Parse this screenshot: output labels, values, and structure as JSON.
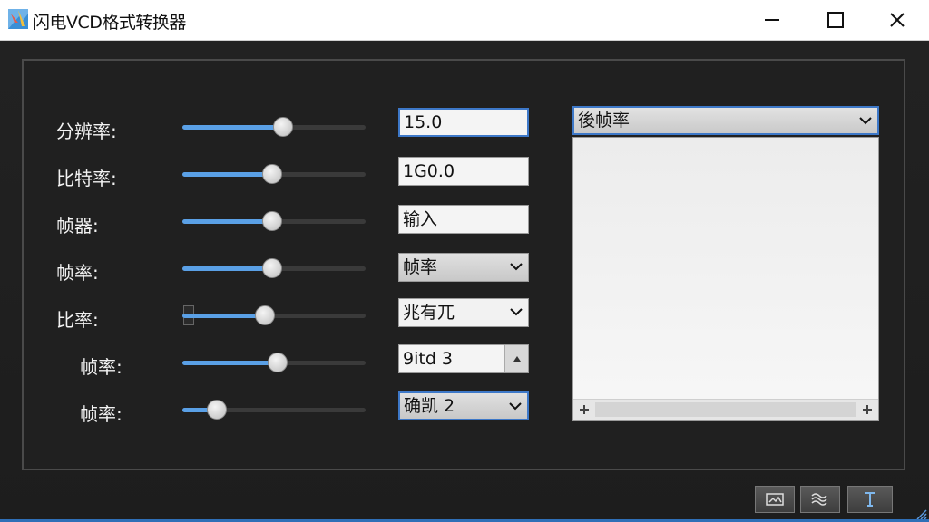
{
  "window": {
    "title": "闪电VCD格式转换器",
    "minimize_icon": "minimize-icon",
    "maximize_icon": "maximize-icon",
    "close_icon": "close-icon"
  },
  "colors": {
    "accent": "#3d78c8",
    "slider_fill": "#5aa0e6",
    "background": "#202020"
  },
  "rows": [
    {
      "label": "分辨率:",
      "slider_value": 0.55,
      "control": "text",
      "value": "15.0",
      "focused": true
    },
    {
      "label": "比特率:",
      "slider_value": 0.49,
      "control": "text",
      "value": "1G0.0"
    },
    {
      "label": "帧器:",
      "slider_value": 0.49,
      "control": "text",
      "value": "输入"
    },
    {
      "label": "帧率:",
      "slider_value": 0.49,
      "control": "select",
      "value": "帧率"
    },
    {
      "label": "比率:",
      "slider_value": 0.45,
      "control": "select",
      "value": "兆有兀"
    },
    {
      "label": "帧率:",
      "slider_value": 0.52,
      "control": "spin",
      "value": "9itd 3"
    },
    {
      "label": "帧率:",
      "slider_value": 0.19,
      "control": "select",
      "value": "确凯 2",
      "focused": true
    }
  ],
  "right_panel": {
    "dropdown_value": "後帧率",
    "scroll_left_icon": "plus-icon",
    "scroll_right_icon": "plus-icon"
  },
  "footer": {
    "buttons": [
      {
        "icon": "image-icon"
      },
      {
        "icon": "waves-icon"
      },
      {
        "icon": "text-cursor-icon"
      }
    ]
  }
}
